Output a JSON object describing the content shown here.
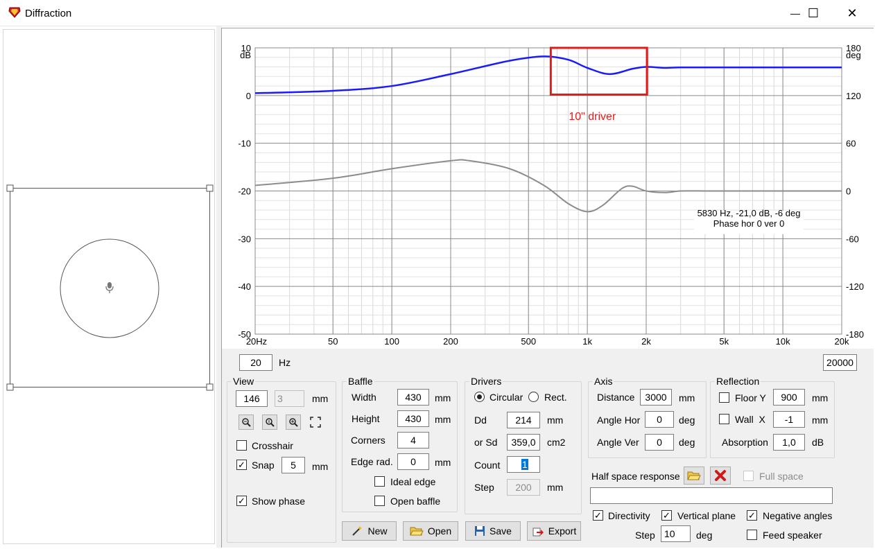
{
  "window": {
    "title": "Diffraction",
    "minimize_glyph": "—",
    "maximize_glyph": "☐",
    "close_glyph": "✕"
  },
  "chart_data": {
    "type": "line",
    "x_scale": "log",
    "xlim": [
      20,
      20000
    ],
    "ylim_left": [
      -50,
      10
    ],
    "ylim_right": [
      -180,
      180
    ],
    "ylabel_left": "dB",
    "ylabel_right": "deg",
    "y_left_ticks": [
      "10",
      "0",
      "-10",
      "-20",
      "-30",
      "-40",
      "-50"
    ],
    "y_right_ticks": [
      "180",
      "120",
      "60",
      "0",
      "-60",
      "-120",
      "-180"
    ],
    "x_tick_values": [
      20,
      50,
      100,
      200,
      500,
      1000,
      2000,
      5000,
      10000,
      20000
    ],
    "x_tick_labels": [
      "20Hz",
      "50",
      "100",
      "200",
      "500",
      "1k",
      "2k",
      "5k",
      "10k",
      "20k"
    ],
    "grid": true,
    "series": [
      {
        "axis": "left",
        "color": "#1a1aff",
        "x": [
          20,
          50,
          100,
          200,
          400,
          600,
          800,
          1000,
          1300,
          1700,
          2000,
          2500,
          3000,
          5000,
          10000,
          20000
        ],
        "values": [
          0.5,
          1.0,
          2.0,
          4.5,
          7.3,
          8.2,
          7.5,
          5.8,
          4.5,
          5.6,
          6.0,
          5.8,
          5.9,
          5.9,
          5.9,
          5.9
        ]
      },
      {
        "axis": "right",
        "color": "#8c8c8c",
        "x": [
          20,
          50,
          100,
          200,
          250,
          400,
          600,
          800,
          1000,
          1200,
          1500,
          1700,
          2000,
          2500,
          3000,
          4000,
          5000,
          10000,
          20000
        ],
        "values": [
          7,
          16,
          28,
          38,
          38,
          28,
          7,
          -16,
          -26,
          -18,
          3,
          6,
          0,
          -2,
          0,
          0,
          0,
          0,
          0
        ]
      }
    ],
    "annotation_box": {
      "x": [
        650,
        2020
      ],
      "y": [
        0.2,
        10
      ]
    },
    "annotation_text": "10\" driver",
    "cursor_readout": [
      "5830 Hz, -21,0 dB, -6 deg",
      "Phase hor 0 ver 0"
    ]
  },
  "freq": {
    "min": "20",
    "unit": "Hz",
    "max": "20000"
  },
  "view": {
    "legend": "View",
    "v1": "146",
    "v2": "3",
    "unit": "mm",
    "crosshair_label": "Crosshair",
    "crosshair_checked": false,
    "snap_label": "Snap",
    "snap_checked": true,
    "snap_value": "5",
    "snap_unit": "mm",
    "show_phase_label": "Show phase",
    "show_phase_checked": true
  },
  "baffle": {
    "legend": "Baffle",
    "width_label": "Width",
    "width": "430",
    "height_label": "Height",
    "height": "430",
    "corners_label": "Corners",
    "corners": "4",
    "edge_label": "Edge rad.",
    "edge": "0",
    "unit": "mm",
    "ideal_edge_label": "Ideal edge",
    "ideal_edge_checked": false,
    "open_baffle_label": "Open baffle",
    "open_baffle_checked": false
  },
  "drivers": {
    "legend": "Drivers",
    "circular_label": "Circular",
    "rect_label": "Rect.",
    "dd_label": "Dd",
    "dd": "214",
    "dd_unit": "mm",
    "sd_label": "or Sd",
    "sd": "359,0",
    "sd_unit": "cm2",
    "count_label": "Count",
    "count": "1",
    "step_label": "Step",
    "step": "200",
    "step_unit": "mm"
  },
  "axis": {
    "legend": "Axis",
    "distance_label": "Distance",
    "distance": "3000",
    "distance_unit": "mm",
    "angle_hor_label": "Angle Hor",
    "angle_hor": "0",
    "angle_ver_label": "Angle Ver",
    "angle_ver": "0",
    "deg": "deg"
  },
  "reflection": {
    "legend": "Reflection",
    "floor_label": "Floor Y",
    "floor": "900",
    "floor_checked": false,
    "wall_label": "Wall  X",
    "wall": "-1",
    "wall_checked": false,
    "absorption_label": "Absorption",
    "absorption": "1,0",
    "absorption_unit": "dB",
    "unit": "mm"
  },
  "half_space": {
    "label": "Half space response",
    "full_space_label": "Full space",
    "full_space_checked": false,
    "path": ""
  },
  "options": {
    "directivity_label": "Directivity",
    "directivity_checked": true,
    "vertical_label": "Vertical plane",
    "vertical_checked": true,
    "negative_label": "Negative angles",
    "negative_checked": true,
    "step_label": "Step",
    "step": "10",
    "step_unit": "deg",
    "feed_label": "Feed speaker",
    "feed_checked": false
  },
  "buttons": {
    "new": "New",
    "open": "Open",
    "save": "Save",
    "export": "Export"
  },
  "icons": {
    "app": "diamond-icon",
    "microphone": "microphone-icon",
    "open_folder": "folder-open-icon",
    "delete": "red-x-icon"
  },
  "colors": {
    "accent": "#1a1aff",
    "phase": "#8c8c8c",
    "annotation": "#e31a1a"
  }
}
